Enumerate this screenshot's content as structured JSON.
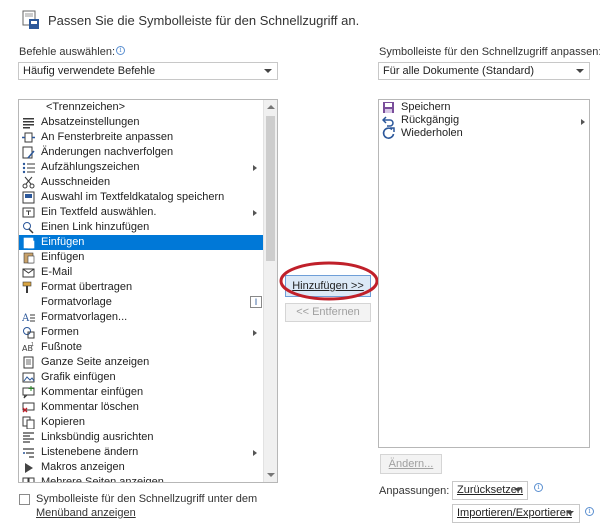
{
  "dialog": {
    "title": "Passen Sie die Symbolleiste für den Schnellzugriff an."
  },
  "left": {
    "choose_label": "Befehle auswählen:",
    "choose_value": "Häufig verwendete Befehle",
    "items": [
      {
        "label": "<Trennzeichen>",
        "icon": "none"
      },
      {
        "label": "Absatzeinstellungen",
        "icon": "paragraph-icon"
      },
      {
        "label": "An Fensterbreite anpassen",
        "icon": "fit-width-icon"
      },
      {
        "label": "Änderungen nachverfolgen",
        "icon": "track-changes-icon"
      },
      {
        "label": "Aufzählungszeichen",
        "icon": "bullets-icon"
      },
      {
        "label": "Ausschneiden",
        "icon": "scissors-icon"
      },
      {
        "label": "Auswahl im Textfeldkatalog speichern",
        "icon": "textbox-save-icon"
      },
      {
        "label": "Ein Textfeld auswählen.",
        "icon": "textbox-icon"
      },
      {
        "label": "Einen Link hinzufügen",
        "icon": "link-icon"
      },
      {
        "label": "Einfügen",
        "icon": "paste-icon"
      },
      {
        "label": "Einfügen",
        "icon": "paste-icon"
      },
      {
        "label": "E-Mail",
        "icon": "email-icon"
      },
      {
        "label": "Format übertragen",
        "icon": "format-painter-icon"
      },
      {
        "label": "Formatvorlage",
        "icon": "none"
      },
      {
        "label": "Formatvorlagen...",
        "icon": "styles-icon"
      },
      {
        "label": "Formen",
        "icon": "shapes-icon"
      },
      {
        "label": "Fußnote",
        "icon": "footnote-icon"
      },
      {
        "label": "Ganze Seite anzeigen",
        "icon": "whole-page-icon"
      },
      {
        "label": "Grafik einfügen",
        "icon": "picture-icon"
      },
      {
        "label": "Kommentar einfügen",
        "icon": "comment-add-icon"
      },
      {
        "label": "Kommentar löschen",
        "icon": "comment-delete-icon"
      },
      {
        "label": "Kopieren",
        "icon": "copy-icon"
      },
      {
        "label": "Linksbündig ausrichten",
        "icon": "align-left-icon"
      },
      {
        "label": "Listenebene ändern",
        "icon": "list-level-icon"
      },
      {
        "label": "Makros anzeigen",
        "icon": "macros-icon"
      },
      {
        "label": "Mehrere Seiten anzeigen",
        "icon": "multi-page-icon"
      }
    ],
    "selected_index": 9,
    "show_below_label": "Symbolleiste für den Schnellzugriff unter dem",
    "show_below_label2": "Menüband anzeigen"
  },
  "middle": {
    "add_label": "Hinzufügen >>",
    "remove_label": "<< Entfernen",
    "highlight_color": "#c0202a"
  },
  "right": {
    "customize_label": "Symbolleiste für den Schnellzugriff anpassen:",
    "customize_value": "Für alle Dokumente (Standard)",
    "items": [
      {
        "label": "Speichern",
        "icon": "save-icon"
      },
      {
        "label": "Rückgängig",
        "icon": "undo-icon"
      },
      {
        "label": "Wiederholen",
        "icon": "redo-icon"
      }
    ],
    "modify_label": "Ändern...",
    "customizations_label": "Anpassungen:",
    "reset_label": "Zurücksetzen",
    "import_export_label": "Importieren/Exportieren"
  },
  "colors": {
    "selection": "#0078d7",
    "accent_blue": "#2b579a"
  }
}
